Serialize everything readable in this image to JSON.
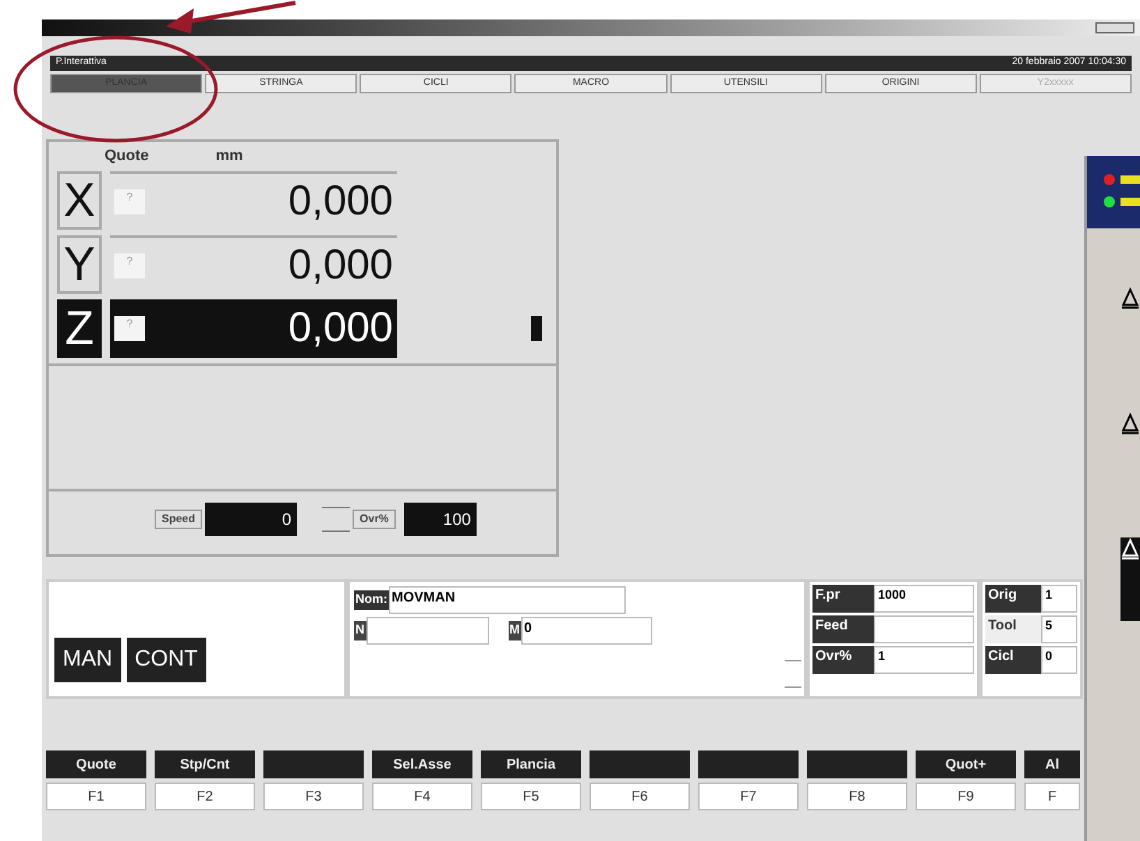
{
  "header": {
    "title": "P.Interattiva",
    "datetime": "20 febbraio 2007 10:04:30"
  },
  "tabs": [
    {
      "label": "PLANCIA",
      "selected": true,
      "disabled": false
    },
    {
      "label": "STRINGA",
      "selected": false,
      "disabled": false
    },
    {
      "label": "CICLI",
      "selected": false,
      "disabled": false
    },
    {
      "label": "MACRO",
      "selected": false,
      "disabled": false
    },
    {
      "label": "UTENSILI",
      "selected": false,
      "disabled": false
    },
    {
      "label": "ORIGINI",
      "selected": false,
      "disabled": false
    },
    {
      "label": "Y2xxxxx",
      "selected": false,
      "disabled": true
    }
  ],
  "positions": {
    "heading": "Quote",
    "unit": "mm",
    "axes": [
      {
        "name": "X",
        "flag": "?",
        "value": "0,000",
        "selected": false
      },
      {
        "name": "Y",
        "flag": "?",
        "value": "0,000",
        "selected": false
      },
      {
        "name": "Z",
        "flag": "?",
        "value": "0,000",
        "selected": true
      }
    ],
    "speed": {
      "label": "Speed",
      "value": "0"
    },
    "override": {
      "label": "Ovr%",
      "value": "100"
    }
  },
  "modes": [
    "MAN",
    "CONT"
  ],
  "program": {
    "nom_label": "Nom:",
    "nom_value": "MOVMAN",
    "n_label": "N",
    "m_label": "M",
    "m_value": "0"
  },
  "params": [
    {
      "label": "F.pr",
      "value": "1000"
    },
    {
      "label": "Feed"
    },
    {
      "label": "Ovr%",
      "value": "1"
    }
  ],
  "status": [
    {
      "label": "Orig",
      "value": "1",
      "highlighted": true
    },
    {
      "label": "Tool",
      "value": "5",
      "highlighted": false
    },
    {
      "label": "Cicl",
      "value": "0",
      "highlighted": true
    }
  ],
  "function_keys": [
    {
      "label": "Quote",
      "key": "F1"
    },
    {
      "label": "Stp/Cnt",
      "key": "F2"
    },
    {
      "key": "F3"
    },
    {
      "label": "Sel.Asse",
      "key": "F4"
    },
    {
      "label": "Plancia",
      "key": "F5"
    },
    {
      "key": "F6"
    },
    {
      "key": "F7"
    },
    {
      "key": "F8"
    },
    {
      "label": "Quot+",
      "key": "F9"
    },
    {
      "label": "Al",
      "key": "F"
    }
  ],
  "side_panel": {
    "items": [
      {
        "selected": false
      },
      {
        "selected": false
      },
      {
        "selected": true
      }
    ]
  }
}
